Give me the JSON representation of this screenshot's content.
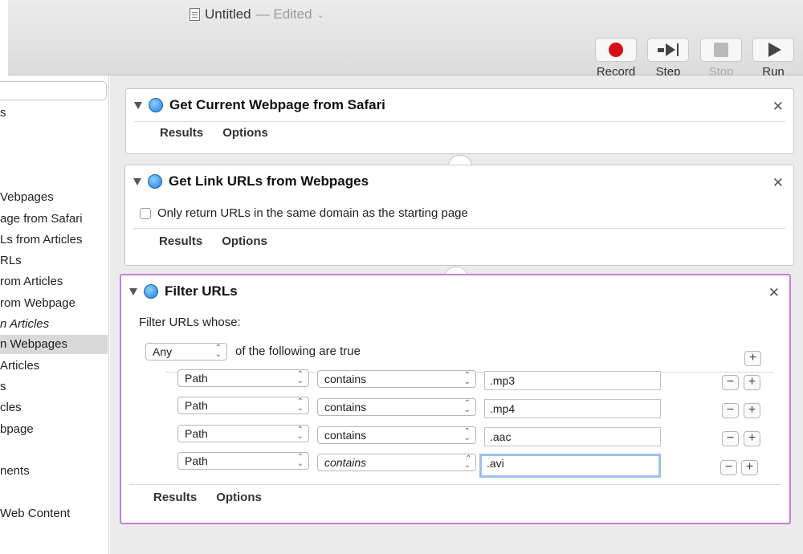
{
  "window": {
    "title": "Untitled",
    "edited": "— Edited"
  },
  "toolbar": {
    "record": "Record",
    "step": "Step",
    "stop": "Stop",
    "run": "Run",
    "record_color": "#d40f1a"
  },
  "library": {
    "items": [
      {
        "label": "s"
      },
      {
        "label": "Vebpages"
      },
      {
        "label": "age from Safari"
      },
      {
        "label": "Ls from Articles"
      },
      {
        "label": "RLs"
      },
      {
        "label": "rom Articles"
      },
      {
        "label": "rom Webpage"
      },
      {
        "label": "n Articles"
      },
      {
        "label": "n Webpages"
      },
      {
        "label": "Articles"
      },
      {
        "label": "s"
      },
      {
        "label": "cles"
      },
      {
        "label": "bpage"
      },
      {
        "label": "nents"
      },
      {
        "label": "Web Content"
      }
    ]
  },
  "actions": {
    "a1": {
      "name": "Get Current Webpage from Safari",
      "tab_results": "Results",
      "tab_options": "Options"
    },
    "a2": {
      "name": "Get Link URLs from Webpages",
      "option_label": "Only return URLs in the same domain as the starting page",
      "tab_results": "Results",
      "tab_options": "Options"
    },
    "a3": {
      "name": "Filter URLs",
      "filter_label": "Filter URLs whose:",
      "match": "Any",
      "match_suffix": "of the following are true",
      "rules": [
        {
          "field": "Path",
          "op": "contains",
          "value": ".mp3"
        },
        {
          "field": "Path",
          "op": "contains",
          "value": ".mp4"
        },
        {
          "field": "Path",
          "op": "contains",
          "value": ".aac"
        },
        {
          "field": "Path",
          "op": "contains",
          "value": ".avi"
        }
      ],
      "tab_results": "Results",
      "tab_options": "Options"
    }
  },
  "icons": {
    "close": "✕",
    "plus": "+",
    "minus": "−",
    "updown": "⌃⌄"
  },
  "colors": {
    "selected_border": "#c77dd6",
    "focus_ring": "#9cc1ec"
  }
}
